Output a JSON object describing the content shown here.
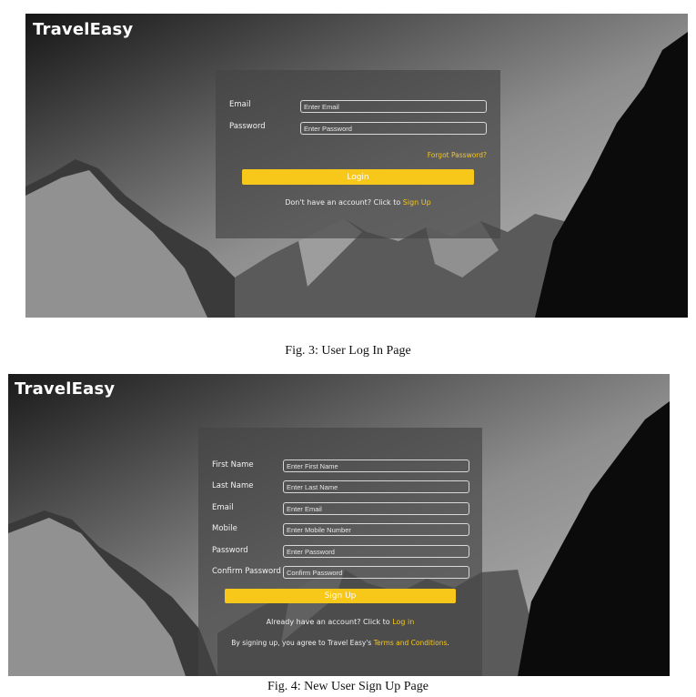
{
  "login_screen": {
    "brand": "TravelEasy",
    "email_label": "Email",
    "email_placeholder": "Enter Email",
    "password_label": "Password",
    "password_placeholder": "Enter Password",
    "forgot_password": "Forgot Password?",
    "login_button": "Login",
    "signup_prompt": "Don't have an account? Click to",
    "signup_link": "Sign Up"
  },
  "caption_login": "Fig. 3: User Log In Page",
  "signup_screen": {
    "brand": "TravelEasy",
    "first_name_label": "First Name",
    "first_name_placeholder": "Enter First Name",
    "last_name_label": "Last Name",
    "last_name_placeholder": "Enter Last Name",
    "email_label": "Email",
    "email_placeholder": "Enter Email",
    "mobile_label": "Mobile",
    "mobile_placeholder": "Enter Mobile Number",
    "password_label": "Password",
    "password_placeholder": "Enter Password",
    "confirm_password_label": "Confirm Password",
    "confirm_password_placeholder": "Confirm Password",
    "signup_button": "Sign Up",
    "login_prompt": "Already have an account? Click to",
    "login_link": "Log in",
    "terms_prefix": "By signing up, you agree to Travel Easy's",
    "terms_link": "Terms and Conditions",
    "terms_suffix": "."
  },
  "caption_signup": "Fig. 4: New User Sign Up Page",
  "colors": {
    "accent": "#f7c71a",
    "panel": "#464646"
  }
}
